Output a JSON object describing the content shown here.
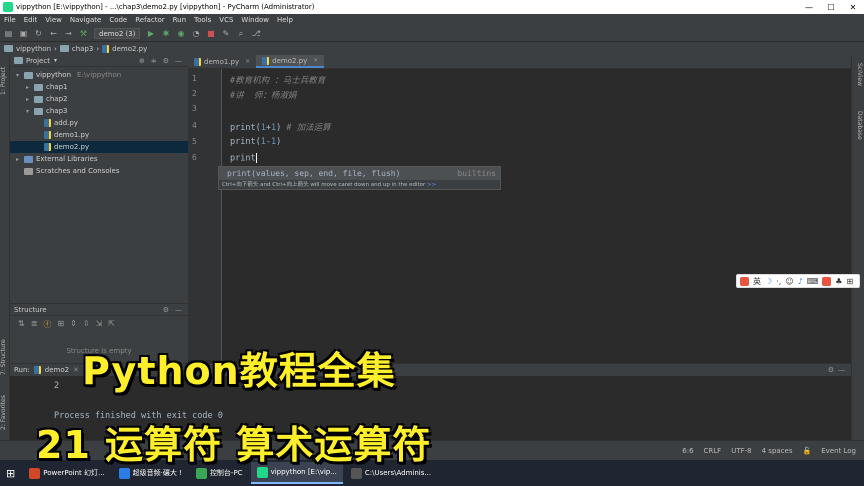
{
  "window": {
    "title": "vippython [E:\\vippython] - ...\\chap3\\demo2.py [vippython] - PyCharm (Administrator)",
    "min": "—",
    "max": "☐",
    "close": "✕"
  },
  "menu": [
    "File",
    "Edit",
    "View",
    "Navigate",
    "Code",
    "Refactor",
    "Run",
    "Tools",
    "VCS",
    "Window",
    "Help"
  ],
  "toolbar": {
    "run_config": "demo2 (3)"
  },
  "breadcrumb": [
    "vippython",
    "chap3",
    "demo2.py"
  ],
  "left_strip": {
    "project_label": "1: Project",
    "structure_label": "7: Structure",
    "favorites_label": "2: Favorites"
  },
  "right_strip": {
    "scview": "SciView",
    "database": "Database"
  },
  "project_panel": {
    "title": "Project",
    "tree": [
      {
        "label": "vippython",
        "extra": "E:\\vippython",
        "level": 0,
        "kind": "folder",
        "arrow": "▾"
      },
      {
        "label": "chap1",
        "extra": "",
        "level": 1,
        "kind": "folder",
        "arrow": "▸"
      },
      {
        "label": "chap2",
        "extra": "",
        "level": 1,
        "kind": "folder",
        "arrow": "▸"
      },
      {
        "label": "chap3",
        "extra": "",
        "level": 1,
        "kind": "folder",
        "arrow": "▾"
      },
      {
        "label": "add.py",
        "extra": "",
        "level": 2,
        "kind": "py",
        "arrow": ""
      },
      {
        "label": "demo1.py",
        "extra": "",
        "level": 2,
        "kind": "py",
        "arrow": ""
      },
      {
        "label": "demo2.py",
        "extra": "",
        "level": 2,
        "kind": "py",
        "arrow": "",
        "selected": true
      },
      {
        "label": "External Libraries",
        "extra": "",
        "level": 0,
        "kind": "lib",
        "arrow": "▸"
      },
      {
        "label": "Scratches and Consoles",
        "extra": "",
        "level": 0,
        "kind": "scratch",
        "arrow": ""
      }
    ]
  },
  "structure_panel": {
    "title": "Structure",
    "empty": "Structure is empty"
  },
  "editor": {
    "tabs": [
      {
        "label": "demo1.py",
        "active": false
      },
      {
        "label": "demo2.py",
        "active": true
      }
    ],
    "line_numbers": [
      "1",
      "2",
      "3",
      "4",
      "5",
      "6"
    ],
    "lines": {
      "l1": "#教育机构 ：马士兵教育",
      "l2": "#讲  师：杨淑娟",
      "l4a": "print(",
      "l4b": "1",
      "l4c": "+",
      "l4d": "1",
      "l4e": ")",
      "l4f": " # 加法运算",
      "l5a": "print(",
      "l5b": "1",
      "l5c": "-",
      "l5d": "1",
      "l5e": ")",
      "l6": "print"
    },
    "popup": {
      "signature": "print(values, sep, end, file, flush)",
      "source": "builtins",
      "hint": "Ctrl+向下箭头 and Ctrl+向上箭头 will move caret down and up in the editor",
      "hint_link": ">>"
    }
  },
  "run_panel": {
    "label": "Run:",
    "tab": "demo2",
    "output_line1": "2",
    "output_line2": "Process finished with exit code 0"
  },
  "status": {
    "position": "6:6",
    "line_sep": "CRLF",
    "encoding": "UTF-8",
    "indent": "4 spaces",
    "event_log": "Event Log"
  },
  "taskbar": {
    "items": [
      {
        "label": "PowerPoint 幻灯...",
        "color": "#d24726"
      },
      {
        "label": "超级音频·碾大 !",
        "color": "#2d7be5"
      },
      {
        "label": "控制台-PC",
        "color": "#3aa757"
      },
      {
        "label": "vippython [E:\\vip...",
        "color": "#21d789",
        "active": true
      },
      {
        "label": "C:\\Users\\Adminis...",
        "color": "#555555"
      }
    ]
  },
  "overlay": {
    "line1": "Python教程全集",
    "line2": "21 运算符 算术运算符"
  },
  "colors": {
    "accent": "#4a88c7",
    "overlay_text": "#ffef2a",
    "ide_bg": "#2b2b2b",
    "panel_bg": "#3c3f41"
  }
}
